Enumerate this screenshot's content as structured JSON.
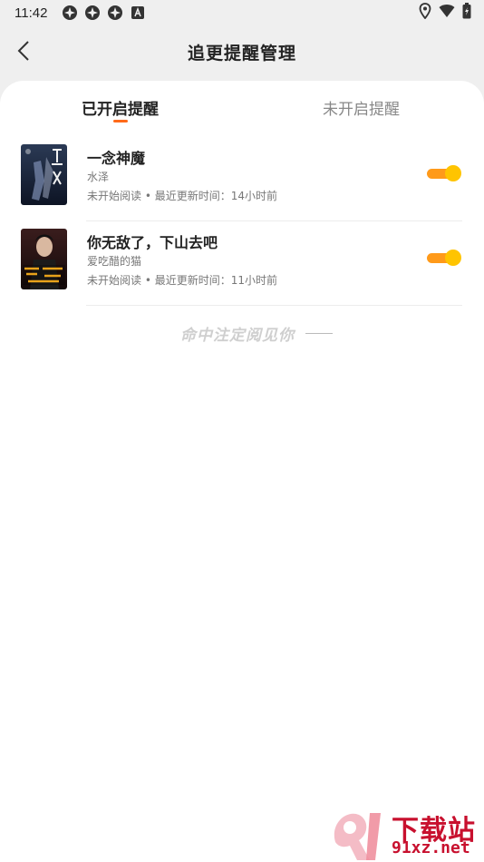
{
  "status_bar": {
    "time": "11:42",
    "icons": [
      "app-icon",
      "app-icon",
      "app-icon",
      "font-icon"
    ],
    "right_icons": [
      "location-icon",
      "wifi-icon",
      "battery-icon"
    ]
  },
  "header": {
    "back_icon": "chevron-left-icon",
    "title": "追更提醒管理"
  },
  "tabs": {
    "active": "已开启提醒",
    "inactive": "未开启提醒"
  },
  "books": [
    {
      "title": "一念神魔",
      "author": "水泽",
      "meta": "未开始阅读 • 最近更新时间：14小时前",
      "reminder_on": true
    },
    {
      "title": "你无敌了，下山去吧",
      "author": "爱吃醋的猫",
      "meta": "未开始阅读 • 最近更新时间：11小时前",
      "reminder_on": true
    }
  ],
  "end_slogan": "命中注定阅见你",
  "colors": {
    "accent": "#ff6a1a",
    "toggle_track": "#ff9a1a",
    "toggle_knob": "#ffc400"
  },
  "watermark": {
    "line1": "下载站",
    "line2": "91xz.net"
  }
}
